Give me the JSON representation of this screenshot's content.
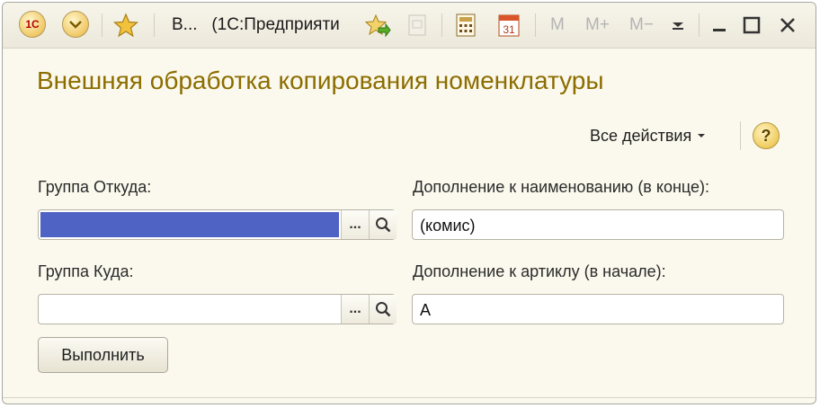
{
  "titlebar": {
    "logo_text": "1С",
    "title_short": "В...",
    "title_app": "(1С:Предприяти",
    "memory_buttons": [
      "M",
      "M+",
      "M−"
    ],
    "calendar_day": "31"
  },
  "form": {
    "heading": "Внешняя обработка копирования номенклатуры",
    "all_actions_label": "Все действия",
    "help_label": "?",
    "group_from_label": "Группа Откуда:",
    "group_from_value": "",
    "group_to_label": "Группа Куда:",
    "group_to_value": "",
    "name_suffix_label": "Дополнение к наименованию (в конце):",
    "name_suffix_value": "(комис)",
    "article_prefix_label": "Дополнение к артиклу (в начале):",
    "article_prefix_value": "А",
    "select_button_label": "...",
    "execute_button_label": "Выполнить"
  },
  "colors": {
    "heading": "#8c6d00",
    "selection_fill": "#4e63c4",
    "window_background": "#fbf9ed"
  }
}
